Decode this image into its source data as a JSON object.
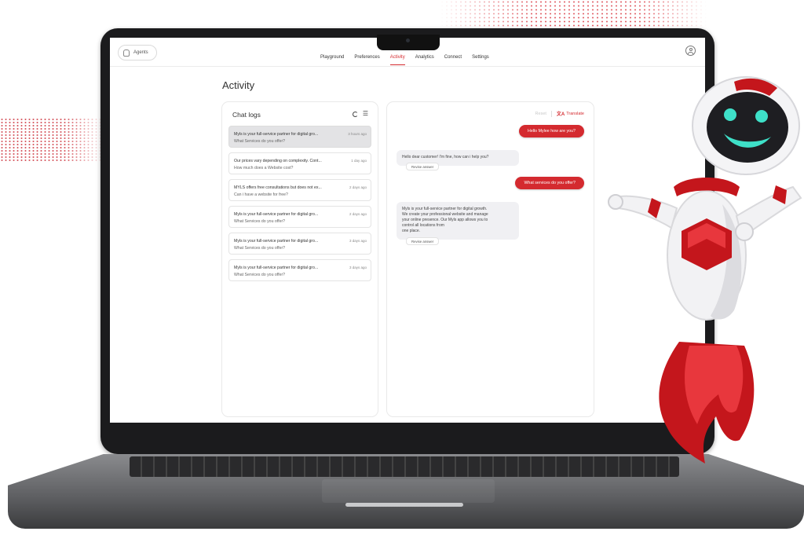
{
  "nav": {
    "agents_label": "Agents",
    "tabs": [
      {
        "label": "Playground"
      },
      {
        "label": "Preferences"
      },
      {
        "label": "Activity",
        "active": true
      },
      {
        "label": "Analytics"
      },
      {
        "label": "Connect"
      },
      {
        "label": "Settings"
      }
    ]
  },
  "page": {
    "title": "Activity"
  },
  "chat_logs": {
    "title": "Chat logs",
    "items": [
      {
        "title": "Myls is your full-service partner for digital gro...",
        "subtitle": "What Services do you offer?",
        "time": "3 hours ago",
        "selected": true
      },
      {
        "title": "Our prices vary depending on complexity. Cont...",
        "subtitle": "How much does a Website cost?",
        "time": "1 day ago"
      },
      {
        "title": "MYLS offers free consultations but does not ex...",
        "subtitle": "Can i have a website for free?",
        "time": "2 days ago"
      },
      {
        "title": "Myls is your full-service partner for digital gro...",
        "subtitle": "What Services do you offer?",
        "time": "2 days ago"
      },
      {
        "title": "Myls is your full-service partner for digital gro...",
        "subtitle": "What Services do you offer?",
        "time": "3 days ago"
      },
      {
        "title": "Myls is your full-service partner for digital gro...",
        "subtitle": "What Services do you offer?",
        "time": "3 days ago"
      }
    ]
  },
  "chat": {
    "reset_label": "Reset",
    "translate_label": "Translate",
    "messages": [
      {
        "role": "user",
        "text": "Hello Mylee how are you?"
      },
      {
        "role": "bot",
        "text": "Hello dear customer! I'm fine, how can i help you?",
        "action": "Revise answer"
      },
      {
        "role": "user",
        "text": "What services do you offer?"
      },
      {
        "role": "bot",
        "lines": [
          "Myls is your full-service partner for digital growth.",
          "We create your professional website and manage",
          "your online presence. Our Myls app allows you to",
          "control all locations from",
          "one place."
        ],
        "action": "Revise answer"
      }
    ]
  },
  "colors": {
    "accent": "#d42a2f",
    "robot_face": "#1e1e22",
    "robot_eyes": "#3ee0c8"
  }
}
